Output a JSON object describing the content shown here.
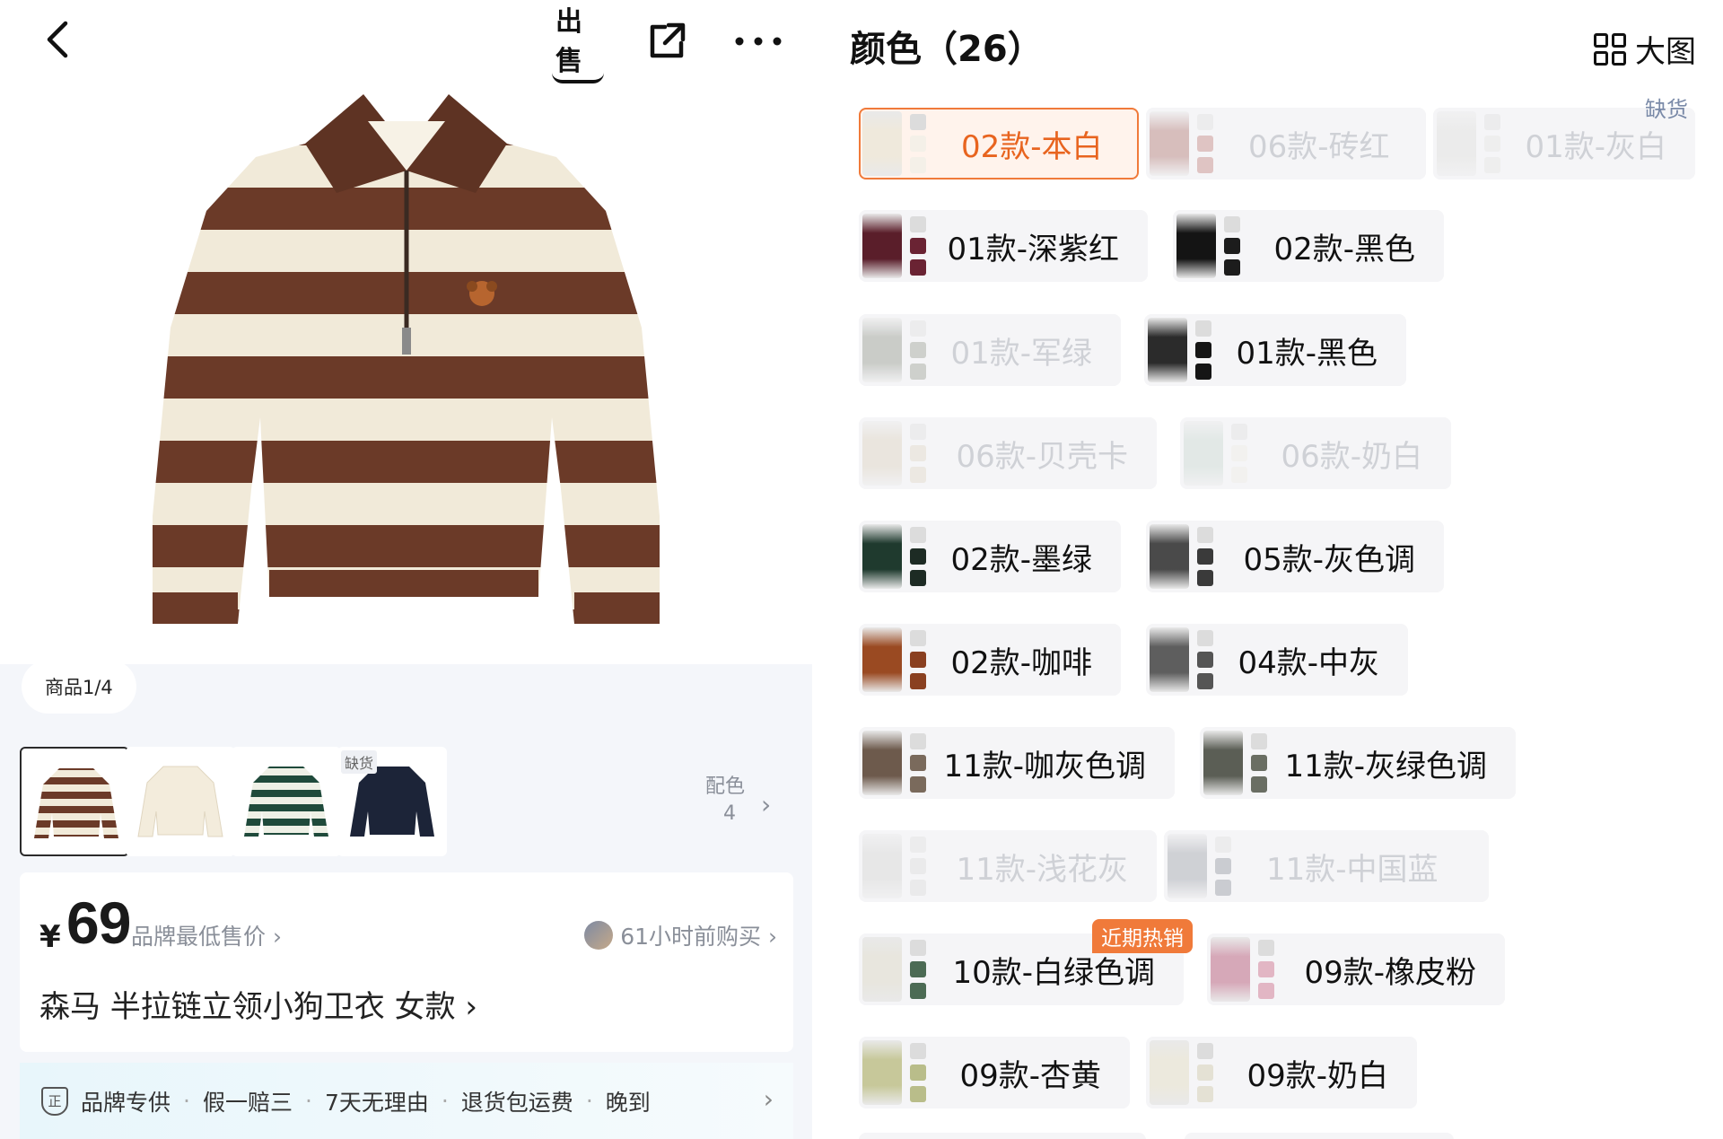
{
  "left": {
    "top_bar": {
      "sell_label": "出售"
    },
    "page_indicator": "商品1/4",
    "thumbnails": [
      {
        "name": "brown-stripe",
        "colors": [
          "#6b3a28",
          "#f1ead9"
        ]
      },
      {
        "name": "cream",
        "colors": [
          "#f3ecdc",
          "#e7dfcc"
        ]
      },
      {
        "name": "green-stripe",
        "colors": [
          "#1f4a3b",
          "#eef0e6"
        ]
      },
      {
        "name": "navy",
        "colors": [
          "#1c2438",
          "#2a3550"
        ],
        "out_of_stock_label": "缺货"
      }
    ],
    "colorways": {
      "label": "配色",
      "count": "4"
    },
    "price": {
      "currency": "¥",
      "value": "69",
      "lowest_label": "品牌最低售价 ›",
      "recent_purchase": "61小时前购买 ›"
    },
    "title": "森马 半拉链立领小狗卫衣 女款 ›",
    "guarantees": [
      "品牌专供",
      "假一赔三",
      "7天无理由",
      "退货包运费",
      "晚到"
    ],
    "guarantee_dot": "·",
    "shield_glyph": "正"
  },
  "right": {
    "header_title": "颜色（26）",
    "big_view_label": "大图",
    "chips": [
      {
        "label": "02款-本白",
        "state": "selected",
        "img": "#efe9dc",
        "side": "#f4f0e8"
      },
      {
        "label": "06款-砖红",
        "state": "disabled",
        "img": "#a05a52",
        "side": "#b86c65"
      },
      {
        "label": "01款-灰白",
        "state": "disabled",
        "img": "#d9d9d4",
        "side": "#e3e3de",
        "tag": "缺货"
      },
      {
        "label": "01款-深紫红",
        "state": "normal",
        "img": "#5a1e2a",
        "side": "#6a2333"
      },
      {
        "label": "02款-黑色",
        "state": "normal",
        "img": "#141414",
        "side": "#1c1c1c"
      },
      {
        "label": "01款-军绿",
        "state": "disabled",
        "img": "#7c8272",
        "side": "#888e7d"
      },
      {
        "label": "01款-黑色",
        "state": "normal",
        "img": "#2b2b2b",
        "side": "#151515"
      },
      {
        "label": "06款-贝壳卡",
        "state": "disabled",
        "img": "#d6c9b0",
        "side": "#ddd2be"
      },
      {
        "label": "06款-奶白",
        "state": "disabled",
        "img": "#bfd2c8",
        "side": "#efece2"
      },
      {
        "label": "02款-墨绿",
        "state": "normal",
        "img": "#1f3a2e",
        "side": "#1d2b24"
      },
      {
        "label": "05款-灰色调",
        "state": "normal",
        "img": "#4a4a4a",
        "side": "#3a3a3a"
      },
      {
        "label": "02款-咖啡",
        "state": "normal",
        "img": "#9a4a22",
        "side": "#8a4020"
      },
      {
        "label": "04款-中灰",
        "state": "normal",
        "img": "#5e5e5e",
        "side": "#555"
      },
      {
        "label": "11款-咖灰色调",
        "state": "normal",
        "img": "#6d5a4c",
        "side": "#7a6a5c"
      },
      {
        "label": "11款-灰绿色调",
        "state": "normal",
        "img": "#5b5e55",
        "side": "#6a6e63"
      },
      {
        "label": "11款-浅花灰",
        "state": "disabled",
        "img": "#cfcfcc",
        "side": "#d8d8d5"
      },
      {
        "label": "11款-中国蓝",
        "state": "disabled",
        "img": "#8a8f98",
        "side": "#7d828b"
      },
      {
        "label": "10款-白绿色调",
        "state": "normal",
        "img": "#e8e6de",
        "side": "#4c6b54",
        "hot": "近期热销"
      },
      {
        "label": "09款-橡皮粉",
        "state": "normal",
        "img": "#d6a8b8",
        "side": "#e2b6c4"
      },
      {
        "label": "09款-杏黄",
        "state": "normal",
        "img": "#c7c89a",
        "side": "#b9bd8a"
      },
      {
        "label": "09款-奶白",
        "state": "normal",
        "img": "#ece9dd",
        "side": "#e4e1d4"
      }
    ]
  }
}
